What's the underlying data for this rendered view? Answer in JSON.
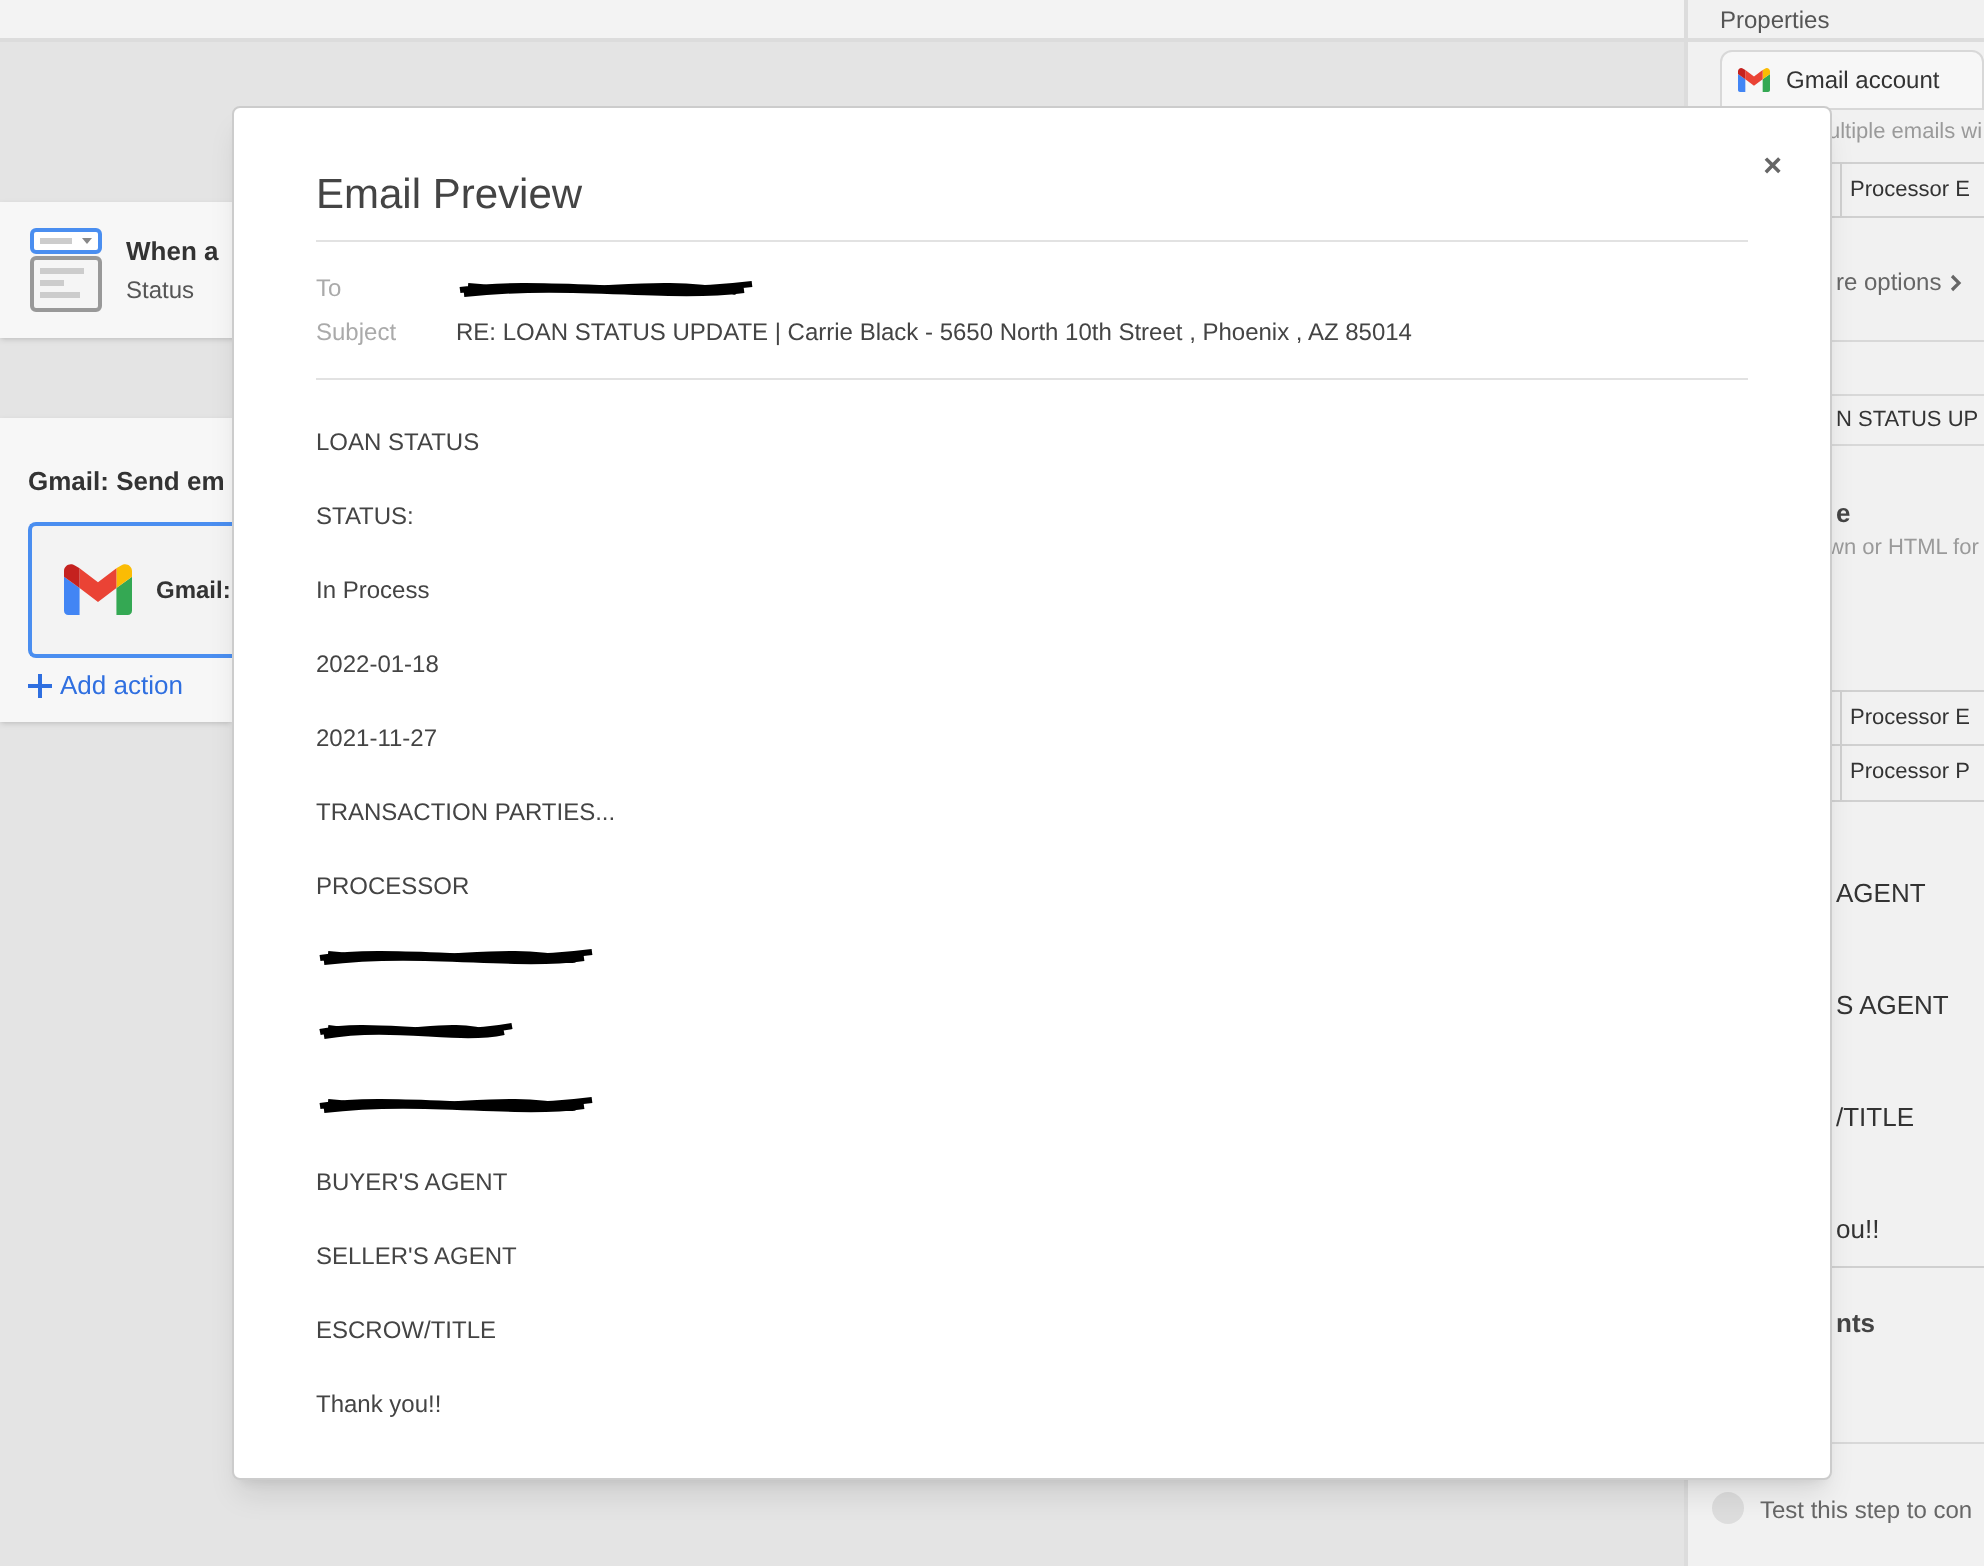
{
  "canvas": {
    "trigger_step": {
      "title": "When a",
      "subtitle": "Status"
    },
    "action_step": {
      "title": "Gmail: Send em",
      "app_label": "Gmail:",
      "add_action": "Add action"
    }
  },
  "properties_panel": {
    "title": "Properties",
    "account_chip": "Gmail account",
    "rows": [
      {
        "kind": "hint",
        "text": "ultiple emails wi"
      },
      {
        "kind": "field",
        "text": "Processor E"
      },
      {
        "kind": "link",
        "text": "re options"
      },
      {
        "kind": "value",
        "text": "N STATUS UP"
      },
      {
        "kind": "label",
        "text": "e"
      },
      {
        "kind": "hint",
        "text": "wn or HTML for"
      },
      {
        "kind": "cell",
        "text": "Processor E"
      },
      {
        "kind": "cell",
        "text": "Processor P"
      },
      {
        "kind": "text",
        "text": "AGENT"
      },
      {
        "kind": "text",
        "text": "S AGENT"
      },
      {
        "kind": "text",
        "text": "/TITLE"
      },
      {
        "kind": "text",
        "text": "ou!!"
      },
      {
        "kind": "section",
        "text": "nts"
      }
    ],
    "test_hint": "Test this step to con"
  },
  "email_preview": {
    "title": "Email Preview",
    "close": "×",
    "fields": [
      {
        "label": "To",
        "kind": "redacted"
      },
      {
        "label": "Subject",
        "kind": "text",
        "value": "RE: LOAN STATUS UPDATE | Carrie Black - 5650 North 10th Street , Phoenix , AZ 85014"
      }
    ],
    "body": [
      {
        "kind": "text",
        "text": "LOAN STATUS"
      },
      {
        "kind": "text",
        "text": "STATUS:"
      },
      {
        "kind": "text",
        "text": "In Process"
      },
      {
        "kind": "text",
        "text": "2022-01-18"
      },
      {
        "kind": "text",
        "text": "2021-11-27"
      },
      {
        "kind": "text",
        "text": "TRANSACTION PARTIES..."
      },
      {
        "kind": "text",
        "text": "PROCESSOR"
      },
      {
        "kind": "redacted"
      },
      {
        "kind": "redacted"
      },
      {
        "kind": "redacted"
      },
      {
        "kind": "text",
        "text": "BUYER'S AGENT"
      },
      {
        "kind": "text",
        "text": "SELLER'S AGENT"
      },
      {
        "kind": "text",
        "text": "ESCROW/TITLE"
      },
      {
        "kind": "text",
        "text": "Thank you!!"
      }
    ]
  }
}
